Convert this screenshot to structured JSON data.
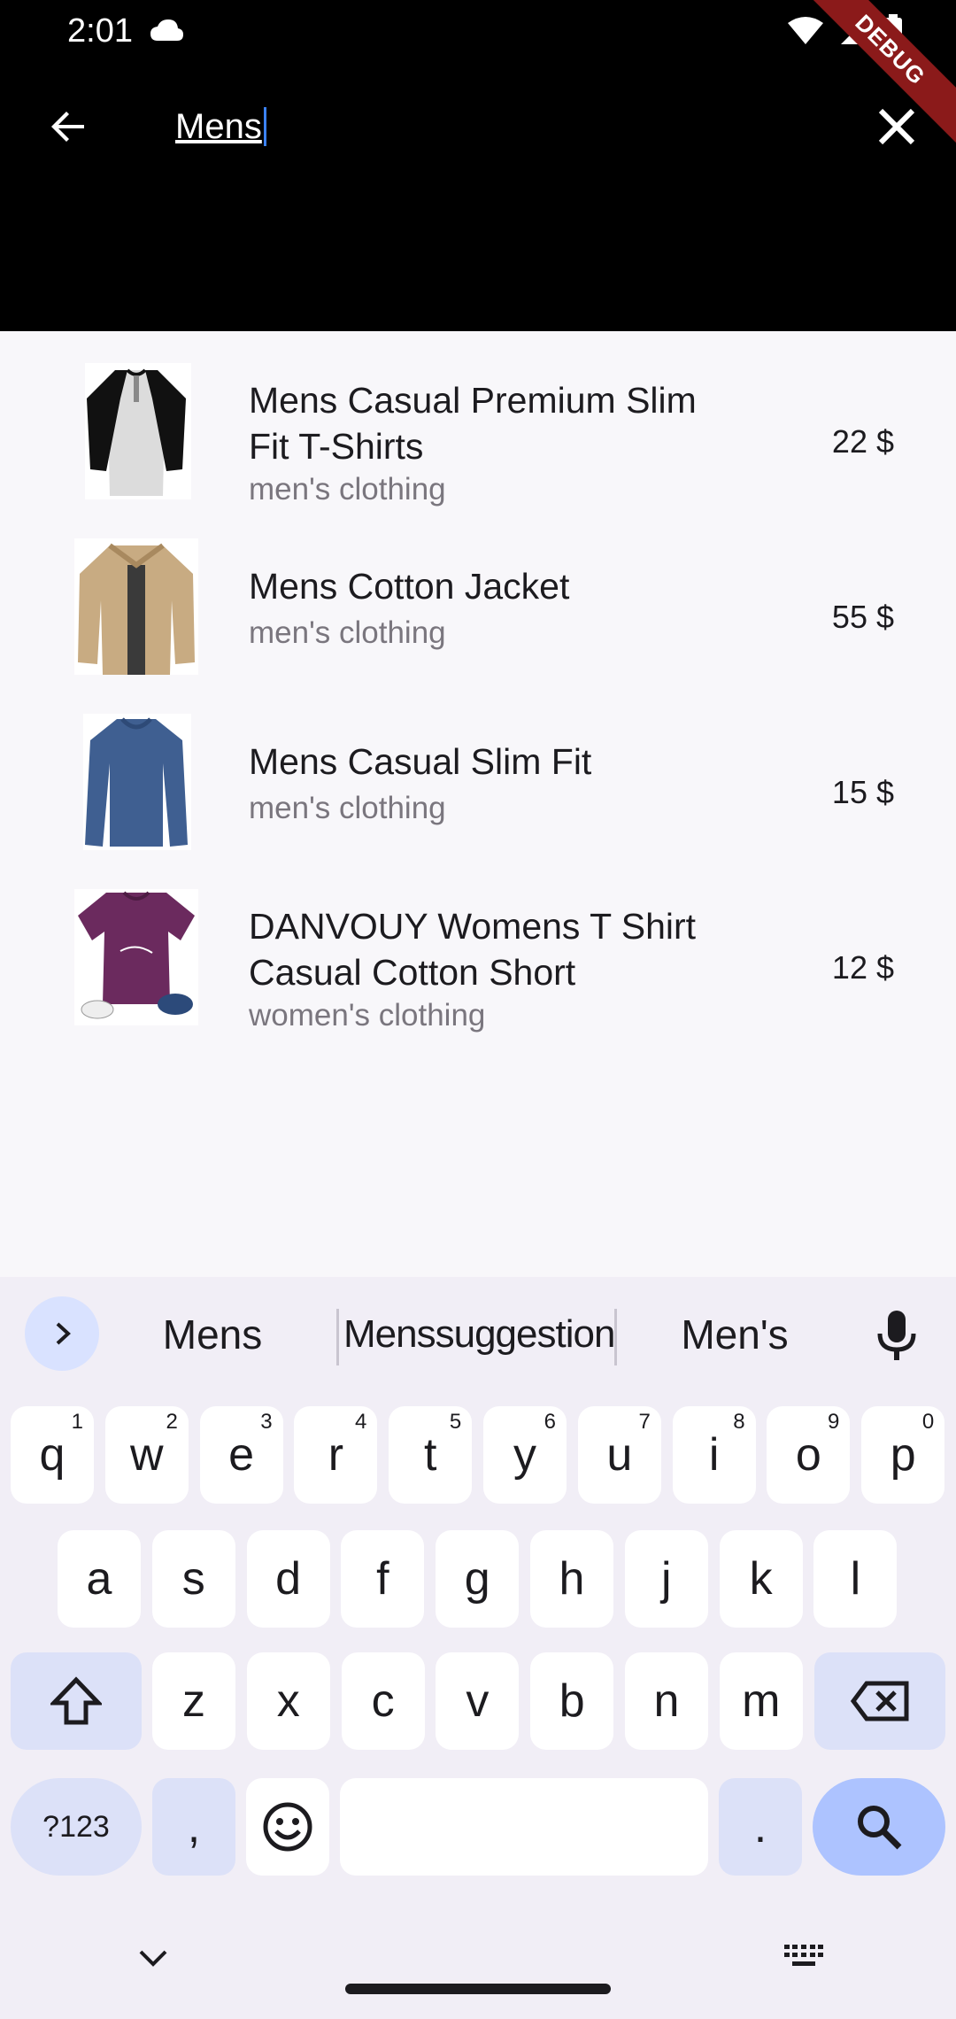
{
  "status_bar": {
    "time": "2:01",
    "debug_label": "DEBUG"
  },
  "search": {
    "query": "Mens"
  },
  "results": [
    {
      "title_line1": "Mens Casual Premium Slim",
      "title_line2": "Fit T-Shirts",
      "category": "men's clothing",
      "price": "22 $"
    },
    {
      "title_line1": "Mens Cotton Jacket",
      "title_line2": "",
      "category": "men's clothing",
      "price": "55 $"
    },
    {
      "title_line1": "Mens Casual Slim Fit",
      "title_line2": "",
      "category": "men's clothing",
      "price": "15 $"
    },
    {
      "title_line1": "DANVOUY Womens T Shirt",
      "title_line2": "Casual Cotton Short",
      "category": "women's clothing",
      "price": "12 $"
    }
  ],
  "keyboard": {
    "suggestions": [
      "Mens",
      "Menssuggestion",
      "Men's"
    ],
    "row1": [
      {
        "k": "q",
        "n": "1"
      },
      {
        "k": "w",
        "n": "2"
      },
      {
        "k": "e",
        "n": "3"
      },
      {
        "k": "r",
        "n": "4"
      },
      {
        "k": "t",
        "n": "5"
      },
      {
        "k": "y",
        "n": "6"
      },
      {
        "k": "u",
        "n": "7"
      },
      {
        "k": "i",
        "n": "8"
      },
      {
        "k": "o",
        "n": "9"
      },
      {
        "k": "p",
        "n": "0"
      }
    ],
    "row2": [
      "a",
      "s",
      "d",
      "f",
      "g",
      "h",
      "j",
      "k",
      "l"
    ],
    "row3": [
      "z",
      "x",
      "c",
      "v",
      "b",
      "n",
      "m"
    ],
    "symbols_label": "?123",
    "comma": ",",
    "period": "."
  },
  "colors": {
    "appbar": "#000000",
    "caret": "#3b82f6",
    "action_key": "#adc3ff",
    "func_key": "#dce1f8"
  }
}
